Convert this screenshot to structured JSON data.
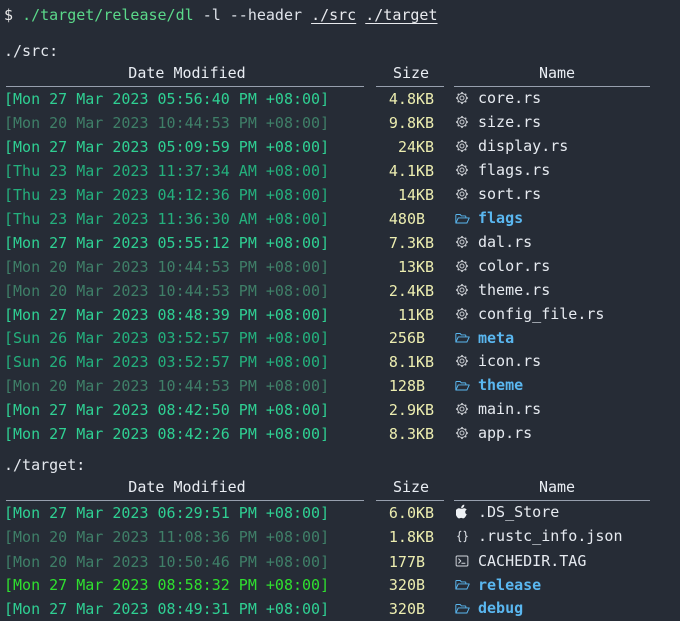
{
  "command_line": {
    "prompt": "$",
    "program": "./target/release/dl",
    "flags": "-l --header",
    "arg1": "./src",
    "arg2": "./target"
  },
  "columns": {
    "date": "Date Modified",
    "size": "Size",
    "name": "Name"
  },
  "sections": [
    {
      "path": "./src:",
      "rows": [
        {
          "date": "[Mon 27 Mar 2023 05:56:40 PM +08:00]",
          "age": "recent",
          "size": "4.8",
          "unit": "KB",
          "name": "core.rs",
          "icon": "rust-icon",
          "kind": "file"
        },
        {
          "date": "[Mon 20 Mar 2023 10:44:53 PM +08:00]",
          "age": "old",
          "size": "9.8",
          "unit": "KB",
          "name": "size.rs",
          "icon": "rust-icon",
          "kind": "file"
        },
        {
          "date": "[Mon 27 Mar 2023 05:09:59 PM +08:00]",
          "age": "recent",
          "size": "24",
          "unit": "KB",
          "name": "display.rs",
          "icon": "rust-icon",
          "kind": "file"
        },
        {
          "date": "[Thu 23 Mar 2023 11:37:34 AM +08:00]",
          "age": "mid",
          "size": "4.1",
          "unit": "KB",
          "name": "flags.rs",
          "icon": "rust-icon",
          "kind": "file"
        },
        {
          "date": "[Thu 23 Mar 2023 04:12:36 PM +08:00]",
          "age": "mid",
          "size": "14",
          "unit": "KB",
          "name": "sort.rs",
          "icon": "rust-icon",
          "kind": "file"
        },
        {
          "date": "[Thu 23 Mar 2023 11:36:30 AM +08:00]",
          "age": "mid",
          "size": "480",
          "unit": "B",
          "name": "flags",
          "icon": "folder-icon",
          "kind": "dir"
        },
        {
          "date": "[Mon 27 Mar 2023 05:55:12 PM +08:00]",
          "age": "recent",
          "size": "7.3",
          "unit": "KB",
          "name": "dal.rs",
          "icon": "rust-icon",
          "kind": "file"
        },
        {
          "date": "[Mon 20 Mar 2023 10:44:53 PM +08:00]",
          "age": "old",
          "size": "13",
          "unit": "KB",
          "name": "color.rs",
          "icon": "rust-icon",
          "kind": "file"
        },
        {
          "date": "[Mon 20 Mar 2023 10:44:53 PM +08:00]",
          "age": "old",
          "size": "2.4",
          "unit": "KB",
          "name": "theme.rs",
          "icon": "rust-icon",
          "kind": "file"
        },
        {
          "date": "[Mon 27 Mar 2023 08:48:39 PM +08:00]",
          "age": "recent",
          "size": "11",
          "unit": "KB",
          "name": "config_file.rs",
          "icon": "rust-icon",
          "kind": "file"
        },
        {
          "date": "[Sun 26 Mar 2023 03:52:57 PM +08:00]",
          "age": "mid",
          "size": "256",
          "unit": "B",
          "name": "meta",
          "icon": "folder-icon",
          "kind": "dir"
        },
        {
          "date": "[Sun 26 Mar 2023 03:52:57 PM +08:00]",
          "age": "mid",
          "size": "8.1",
          "unit": "KB",
          "name": "icon.rs",
          "icon": "rust-icon",
          "kind": "file"
        },
        {
          "date": "[Mon 20 Mar 2023 10:44:53 PM +08:00]",
          "age": "old",
          "size": "128",
          "unit": "B",
          "name": "theme",
          "icon": "folder-icon",
          "kind": "dir"
        },
        {
          "date": "[Mon 27 Mar 2023 08:42:50 PM +08:00]",
          "age": "recent",
          "size": "2.9",
          "unit": "KB",
          "name": "main.rs",
          "icon": "rust-icon",
          "kind": "file"
        },
        {
          "date": "[Mon 27 Mar 2023 08:42:26 PM +08:00]",
          "age": "recent",
          "size": "8.3",
          "unit": "KB",
          "name": "app.rs",
          "icon": "rust-icon",
          "kind": "file"
        }
      ]
    },
    {
      "path": "./target:",
      "rows": [
        {
          "date": "[Mon 27 Mar 2023 06:29:51 PM +08:00]",
          "age": "recent",
          "size": "6.0",
          "unit": "KB",
          "name": ".DS_Store",
          "icon": "apple-icon",
          "kind": "file"
        },
        {
          "date": "[Mon 20 Mar 2023 11:08:36 PM +08:00]",
          "age": "old",
          "size": "1.8",
          "unit": "KB",
          "name": ".rustc_info.json",
          "icon": "braces-icon",
          "kind": "file"
        },
        {
          "date": "[Mon 20 Mar 2023 10:50:46 PM +08:00]",
          "age": "old",
          "size": "177",
          "unit": "B",
          "name": "CACHEDIR.TAG",
          "icon": "terminal-icon",
          "kind": "file"
        },
        {
          "date": "[Mon 27 Mar 2023 08:58:32 PM +08:00]",
          "age": "new",
          "size": "320",
          "unit": "B",
          "name": "release",
          "icon": "folder-icon",
          "kind": "dir"
        },
        {
          "date": "[Mon 27 Mar 2023 08:49:31 PM +08:00]",
          "age": "recent",
          "size": "320",
          "unit": "B",
          "name": "debug",
          "icon": "folder-icon",
          "kind": "dir"
        }
      ]
    }
  ],
  "colors": {
    "background": "#262c36",
    "date_new": "#2fe02f",
    "date_recent": "#2fd093",
    "date_mid": "#24b07d",
    "date_old": "#3f7f68",
    "size": "#ecedb0",
    "dir_name": "#5ab7f0",
    "file_name": "#e6eaf0",
    "command_path": "#5bd98a"
  }
}
